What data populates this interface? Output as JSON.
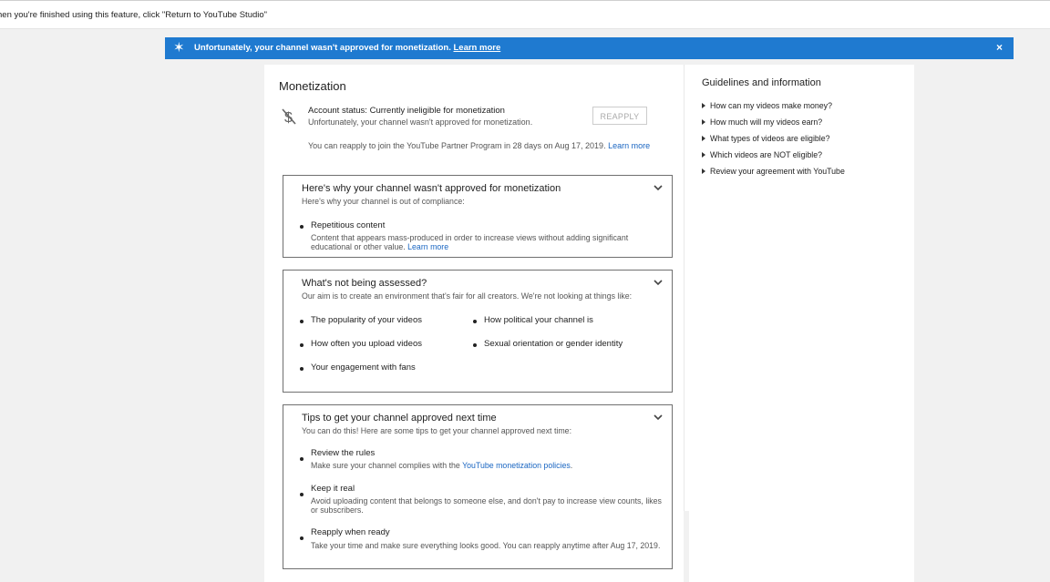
{
  "topbar": {
    "text": "hen you're finished using this feature, click \"Return to YouTube Studio\""
  },
  "banner": {
    "icon": "star-icon",
    "message": "Unfortunately, your channel wasn't approved for monetization.",
    "link": "Learn more",
    "close": "×",
    "color": "#1f7ad0"
  },
  "main": {
    "title": "Monetization",
    "status": {
      "icon": "no-dollar-icon",
      "label": "Account status: Currently ineligible for monetization",
      "sub": "Unfortunately, your channel wasn't approved for monetization.",
      "button": "REAPPLY",
      "note": "You can reapply to join the YouTube Partner Program in 28 days on Aug 17, 2019.",
      "note_link": "Learn more"
    },
    "why": {
      "title": "Here's why your channel wasn't approved for monetization",
      "sub": "Here's why your channel is out of compliance:",
      "item_title": "Repetitious content",
      "item_desc": "Content that appears mass-produced in order to increase views without adding significant educational or other value.",
      "item_link": "Learn more"
    },
    "assessed": {
      "title": "What's not being assessed?",
      "sub": "Our aim is to create an environment that's fair for all creators. We're not looking at things like:",
      "items": [
        "The popularity of your videos",
        "How political your channel is",
        "How often you upload videos",
        "Sexual orientation or gender identity",
        "Your engagement with fans"
      ]
    },
    "tips": {
      "title": "Tips to get your channel approved next time",
      "sub": "You can do this! Here are some tips to get your channel approved next time:",
      "items": [
        {
          "title": "Review the rules",
          "desc": "Make sure your channel complies with the ",
          "link": "YouTube monetization policies",
          "after": "."
        },
        {
          "title": "Keep it real",
          "desc": "Avoid uploading content that belongs to someone else, and don't pay to increase view counts, likes or subscribers."
        },
        {
          "title": "Reapply when ready",
          "desc": "Take your time and make sure everything looks good. You can reapply anytime after Aug 17, 2019."
        }
      ]
    }
  },
  "side": {
    "title": "Guidelines and information",
    "items": [
      "How can my videos make money?",
      "How much will my videos earn?",
      "What types of videos are eligible?",
      "Which videos are NOT eligible?",
      "Review your agreement with YouTube"
    ]
  },
  "colors": {
    "link": "#1a66c2",
    "banner": "#1f7ad0"
  }
}
